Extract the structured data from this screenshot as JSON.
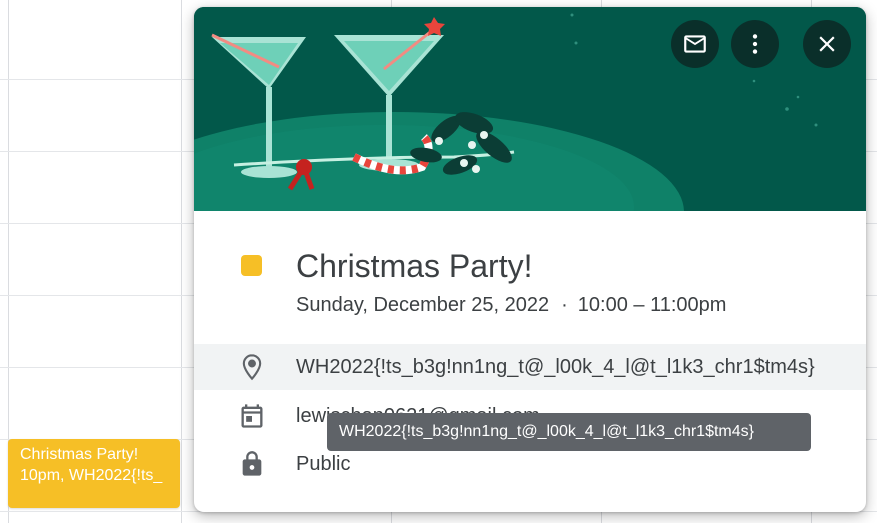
{
  "calendar": {
    "event_chip": {
      "title": "Christmas Party!",
      "subtitle": "10pm, WH2022{!ts_"
    }
  },
  "popup": {
    "actions": {
      "email_icon": "mail-icon",
      "more_icon": "more-vert-icon",
      "close_icon": "close-icon"
    },
    "event": {
      "color": "#f6bf26",
      "title": "Christmas Party!",
      "date": "Sunday, December 25, 2022",
      "separator": "·",
      "time": "10:00 – 11:00pm"
    },
    "details": {
      "location": "WH2022{!ts_b3g!nn1ng_t@_l00k_4_l@t_l1k3_chr1$tm4s}",
      "calendar_owner": "lewischan0621@gmail.com",
      "visibility": "Public"
    }
  },
  "tooltip": {
    "text": "WH2022{!ts_b3g!nn1ng_t@_l00k_4_l@t_l1k3_chr1$tm4s}"
  }
}
